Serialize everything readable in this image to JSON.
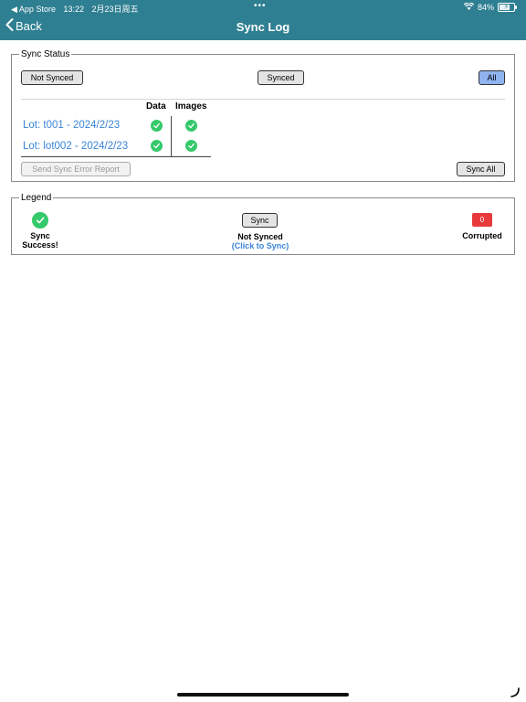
{
  "status_bar": {
    "back_app": "◀ App Store",
    "time": "13:22",
    "date": "2月23日周五",
    "dots": "•••",
    "battery_percent": "84%"
  },
  "header": {
    "back_label": "Back",
    "title": "Sync Log"
  },
  "sync_status": {
    "legend": "Sync Status",
    "filters": {
      "not_synced": "Not Synced",
      "synced": "Synced",
      "all": "All",
      "selected": "All"
    },
    "columns": {
      "data": "Data",
      "images": "Images"
    },
    "rows": [
      {
        "label": "Lot: t001 - 2024/2/23",
        "data_synced": true,
        "images_synced": true
      },
      {
        "label": "Lot: lot002 - 2024/2/23",
        "data_synced": true,
        "images_synced": true
      }
    ],
    "send_report_label": "Send Sync Error Report",
    "sync_all_label": "Sync All"
  },
  "legend_box": {
    "legend": "Legend",
    "success_line1": "Sync",
    "success_line2": "Success!",
    "sync_button_label": "Sync",
    "not_synced_label": "Not Synced",
    "click_to_sync": "(Click to Sync)",
    "corrupt_count": "0",
    "corrupted_label": "Corrupted"
  },
  "colors": {
    "header_bg": "#2f7f92",
    "link": "#3a84d8",
    "success": "#35c96b",
    "corrupt": "#e83a3a",
    "selected_filter": "#8fb4ef"
  }
}
